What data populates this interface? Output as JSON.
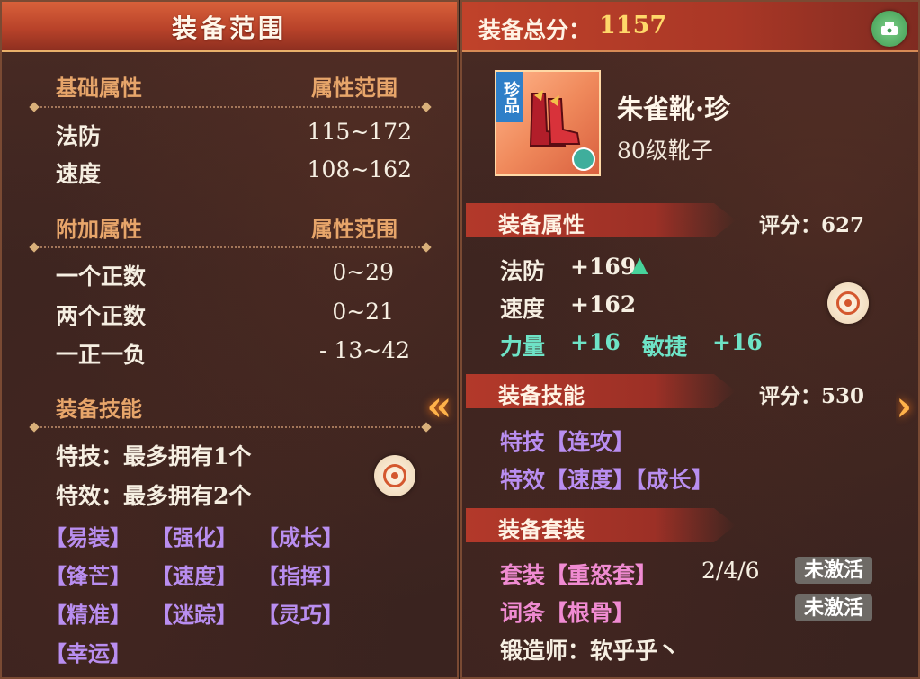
{
  "left": {
    "title": "装备范围",
    "base_header": "基础属性",
    "base_range_header": "属性范围",
    "base_stats": [
      {
        "name": "法防",
        "range": "115~172"
      },
      {
        "name": "速度",
        "range": "108~162"
      }
    ],
    "extra_header": "附加属性",
    "extra_range_header": "属性范围",
    "extra_stats": [
      {
        "name": "一个正数",
        "range": "0~29"
      },
      {
        "name": "两个正数",
        "range": "0~21"
      },
      {
        "name": "一正一负",
        "range": "- 13~42"
      }
    ],
    "skill_header": "装备技能",
    "skill_lines": [
      "特技：最多拥有1个",
      "特效：最多拥有2个"
    ],
    "effect_tags": [
      "【易装】",
      "【强化】",
      "【成长】",
      "【锋芒】",
      "【速度】",
      "【指挥】",
      "【精准】",
      "【迷踪】",
      "【灵巧】",
      "【幸运】"
    ]
  },
  "right": {
    "score_label": "装备总分：",
    "score_value": "1157",
    "item": {
      "rarity": "珍品",
      "name": "朱雀靴·珍",
      "level": "80级靴子"
    },
    "attr_section": {
      "title": "装备属性",
      "score": "评分：627"
    },
    "attrs": [
      {
        "name": "法防",
        "value": "+169"
      },
      {
        "name": "速度",
        "value": "+162"
      }
    ],
    "green_attrs": [
      {
        "name": "力量",
        "value": "+16"
      },
      {
        "name": "敏捷",
        "value": "+16"
      }
    ],
    "skill_section": {
      "title": "装备技能",
      "score": "评分：530"
    },
    "skill_lines": [
      "特技【连攻】",
      "特效【速度】【成长】"
    ],
    "set_section": {
      "title": "装备套装"
    },
    "set_line": {
      "label": "套装【重怒套】",
      "progress": "2/4/6",
      "status": "未激活"
    },
    "entry_line": {
      "label": "词条【根骨】",
      "status": "未激活"
    },
    "forger_line": "锻造师：软乎乎丶"
  },
  "colors": {
    "accent_gold": "#ffd86a",
    "tag_purple": "#b98ef0",
    "stat_green": "#6ee3c6",
    "set_pink": "#f08bd2"
  }
}
